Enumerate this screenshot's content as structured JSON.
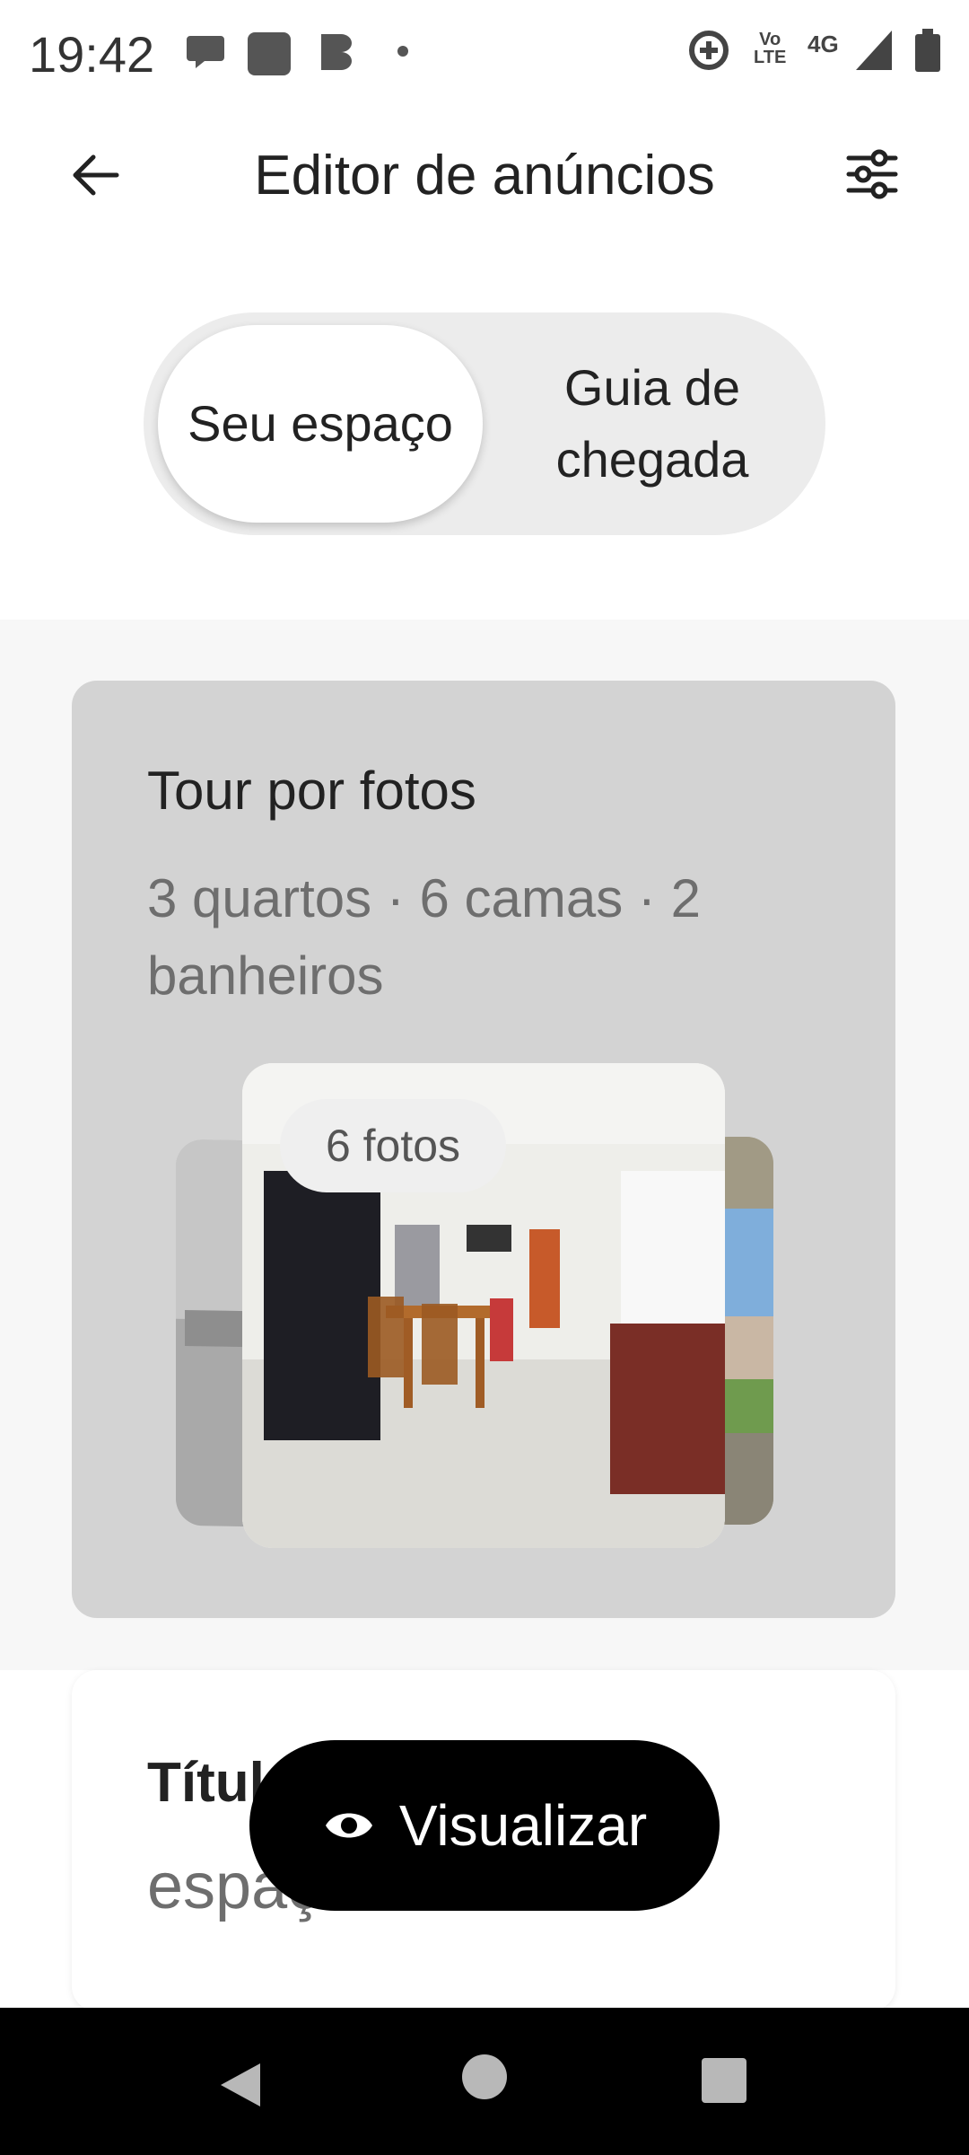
{
  "status_bar": {
    "time": "19:42",
    "network_label": "4G",
    "volte_label": "Vo\nLTE"
  },
  "header": {
    "title": "Editor de anúncios"
  },
  "segments": [
    {
      "label": "Seu espaço",
      "selected": true
    },
    {
      "label": "Guia de chegada",
      "selected": false
    }
  ],
  "photo_tour": {
    "title": "Tour por fotos",
    "summary": "3 quartos · 6 camas · 2 banheiros",
    "badge": "6 fotos"
  },
  "title_card": {
    "title": "Títul",
    "value": "espaço vida"
  },
  "preview_button": {
    "label": "Visualizar"
  },
  "colors": {
    "accent": "#000000",
    "card_bg": "#d3d3d3",
    "segment_bg": "#ececec"
  }
}
